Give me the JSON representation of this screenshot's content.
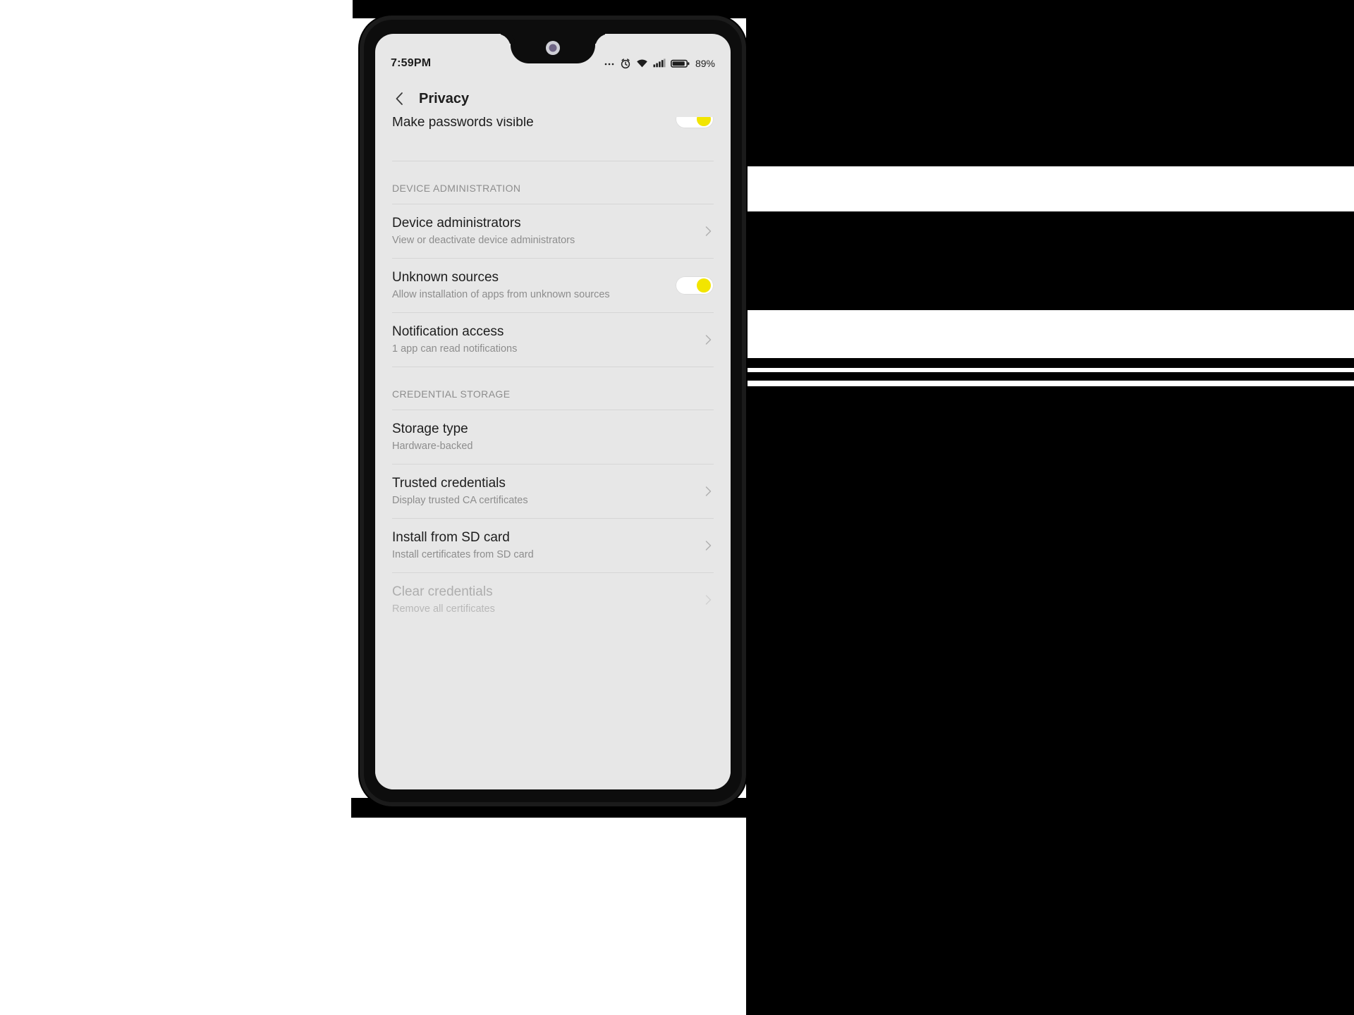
{
  "status_bar": {
    "time": "7:59PM",
    "battery_percent": "89%",
    "icons": [
      "overflow-dots-icon",
      "alarm-icon",
      "wifi-icon",
      "signal-icon",
      "battery-icon"
    ]
  },
  "app_bar": {
    "back_icon": "back-chevron-icon",
    "title": "Privacy"
  },
  "colors": {
    "accent": "#f2e500",
    "screen_background": "#e7e7e7",
    "title_text": "#1d1d1d",
    "secondary_text": "#8d8d8d",
    "disabled_text": "#aeaeae",
    "divider": "#d6d6d6"
  },
  "list": {
    "passwords_row": {
      "title": "Make passwords visible",
      "toggle_state": "on"
    },
    "device_administration_header": "DEVICE ADMINISTRATION",
    "device_administrators": {
      "title": "Device administrators",
      "subtitle": "View or deactivate device administrators"
    },
    "unknown_sources": {
      "title": "Unknown sources",
      "subtitle": "Allow installation of apps from unknown sources",
      "toggle_state": "on"
    },
    "notification_access": {
      "title": "Notification access",
      "subtitle": "1 app can read notifications"
    },
    "credential_storage_header": "CREDENTIAL STORAGE",
    "storage_type": {
      "title": "Storage type",
      "subtitle": "Hardware-backed"
    },
    "trusted_credentials": {
      "title": "Trusted credentials",
      "subtitle": "Display trusted CA certificates"
    },
    "install_from_sd": {
      "title": "Install from SD card",
      "subtitle": "Install certificates from SD card"
    },
    "clear_credentials": {
      "title": "Clear credentials",
      "subtitle": "Remove all certificates"
    }
  }
}
